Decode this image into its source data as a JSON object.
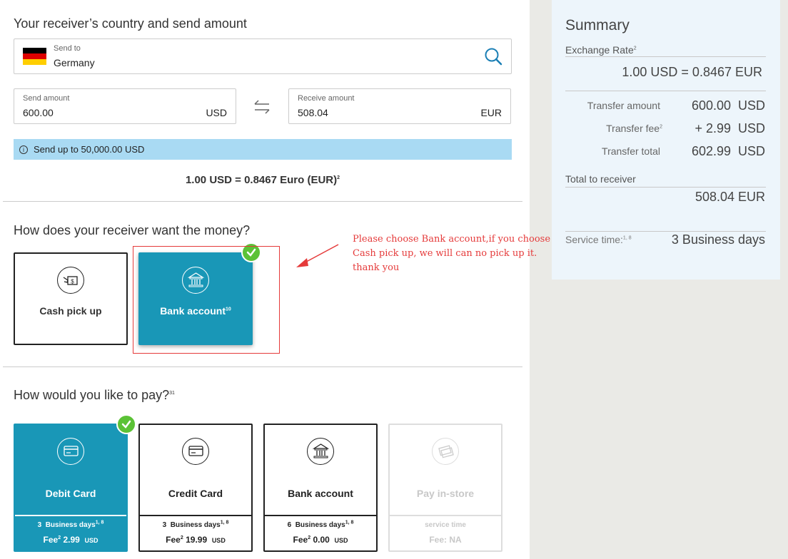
{
  "receiver_section": {
    "title": "Your receiver’s country and send amount",
    "send_to_label": "Send to",
    "send_to_value": "Germany",
    "send_amount_label": "Send amount",
    "send_amount_value": "600.00",
    "send_currency": "USD",
    "receive_amount_label": "Receive amount",
    "receive_amount_value": "508.04",
    "receive_currency": "EUR",
    "limit_info": "Send up to 50,000.00 USD",
    "rate_text": "1.00 USD = 0.8467 Euro (EUR)",
    "rate_sup": "2"
  },
  "delivery_section": {
    "title": "How does your receiver want the money?",
    "options": [
      {
        "label": "Cash pick up",
        "sup": "",
        "selected": false,
        "icon": "cash-pickup-icon"
      },
      {
        "label": "Bank account",
        "sup": "10",
        "selected": true,
        "icon": "bank-icon"
      }
    ]
  },
  "annotation": {
    "text": "Please choose Bank account,if you choose Cash pick up, we will can no pick up it. thank you",
    "color": "#e53a3a"
  },
  "payment_section": {
    "title": "How would you like to pay?",
    "title_sup": "31",
    "options": [
      {
        "label": "Debit Card",
        "days_num": "3",
        "days_text": "Business days",
        "days_sup": "1, 8",
        "fee_label": "Fee",
        "fee_sup": "2",
        "fee_value": "2.99",
        "fee_currency": "USD",
        "selected": true,
        "disabled": false,
        "icon": "debit-card-icon"
      },
      {
        "label": "Credit Card",
        "days_num": "3",
        "days_text": "Business days",
        "days_sup": "1, 8",
        "fee_label": "Fee",
        "fee_sup": "2",
        "fee_value": "19.99",
        "fee_currency": "USD",
        "selected": false,
        "disabled": false,
        "icon": "credit-card-icon"
      },
      {
        "label": "Bank account",
        "days_num": "6",
        "days_text": "Business days",
        "days_sup": "1, 8",
        "fee_label": "Fee",
        "fee_sup": "2",
        "fee_value": "0.00",
        "fee_currency": "USD",
        "selected": false,
        "disabled": false,
        "icon": "bank-icon"
      },
      {
        "label": "Pay in-store",
        "service_text": "service time",
        "fee_na": "Fee: NA",
        "selected": false,
        "disabled": true,
        "icon": "cash-store-icon"
      }
    ]
  },
  "summary": {
    "title": "Summary",
    "exchange_rate_label": "Exchange Rate",
    "exchange_rate_sup": "2",
    "exchange_rate_value": "1.00 USD = 0.8467 EUR",
    "transfer_amount_label": "Transfer amount",
    "transfer_amount_value": "600.00  USD",
    "transfer_fee_label": "Transfer fee",
    "transfer_fee_sup": "2",
    "transfer_fee_value": "+ 2.99  USD",
    "transfer_total_label": "Transfer total",
    "transfer_total_value": "602.99  USD",
    "total_receiver_label": "Total to receiver",
    "total_receiver_value": "508.04 EUR",
    "service_time_label": "Service time:",
    "service_time_sup": "1, 8",
    "service_time_value": "3 Business days"
  },
  "colors": {
    "accent": "#1997b7",
    "check": "#5bc236",
    "info_bar": "#a9daf3",
    "summary_bg": "#edf5fb",
    "annotation": "#e53a3a"
  }
}
